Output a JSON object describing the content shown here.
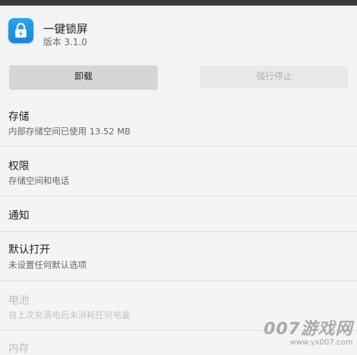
{
  "app": {
    "name": "一键锁屏",
    "version": "版本 3.1.0"
  },
  "buttons": {
    "uninstall": "卸载",
    "force_stop": "强行停止"
  },
  "sections": [
    {
      "title": "存储",
      "subtitle": "内部存储空间已使用 13.52 MB",
      "enabled": true
    },
    {
      "title": "权限",
      "subtitle": "存储空间和电话",
      "enabled": true
    },
    {
      "title": "通知",
      "subtitle": "",
      "enabled": true
    },
    {
      "title": "默认打开",
      "subtitle": "未设置任何默认选项",
      "enabled": true
    },
    {
      "title": "电池",
      "subtitle": "自上次充满电后未消耗任何电量",
      "enabled": false
    },
    {
      "title": "内存",
      "subtitle": "",
      "enabled": false
    }
  ],
  "watermark": {
    "text": "007游戏网",
    "url": "www.yx007.com"
  },
  "colors": {
    "background": "#f4f4f4",
    "icon_blue": "#1f95e6",
    "disabled_text": "#bdbdbd"
  }
}
